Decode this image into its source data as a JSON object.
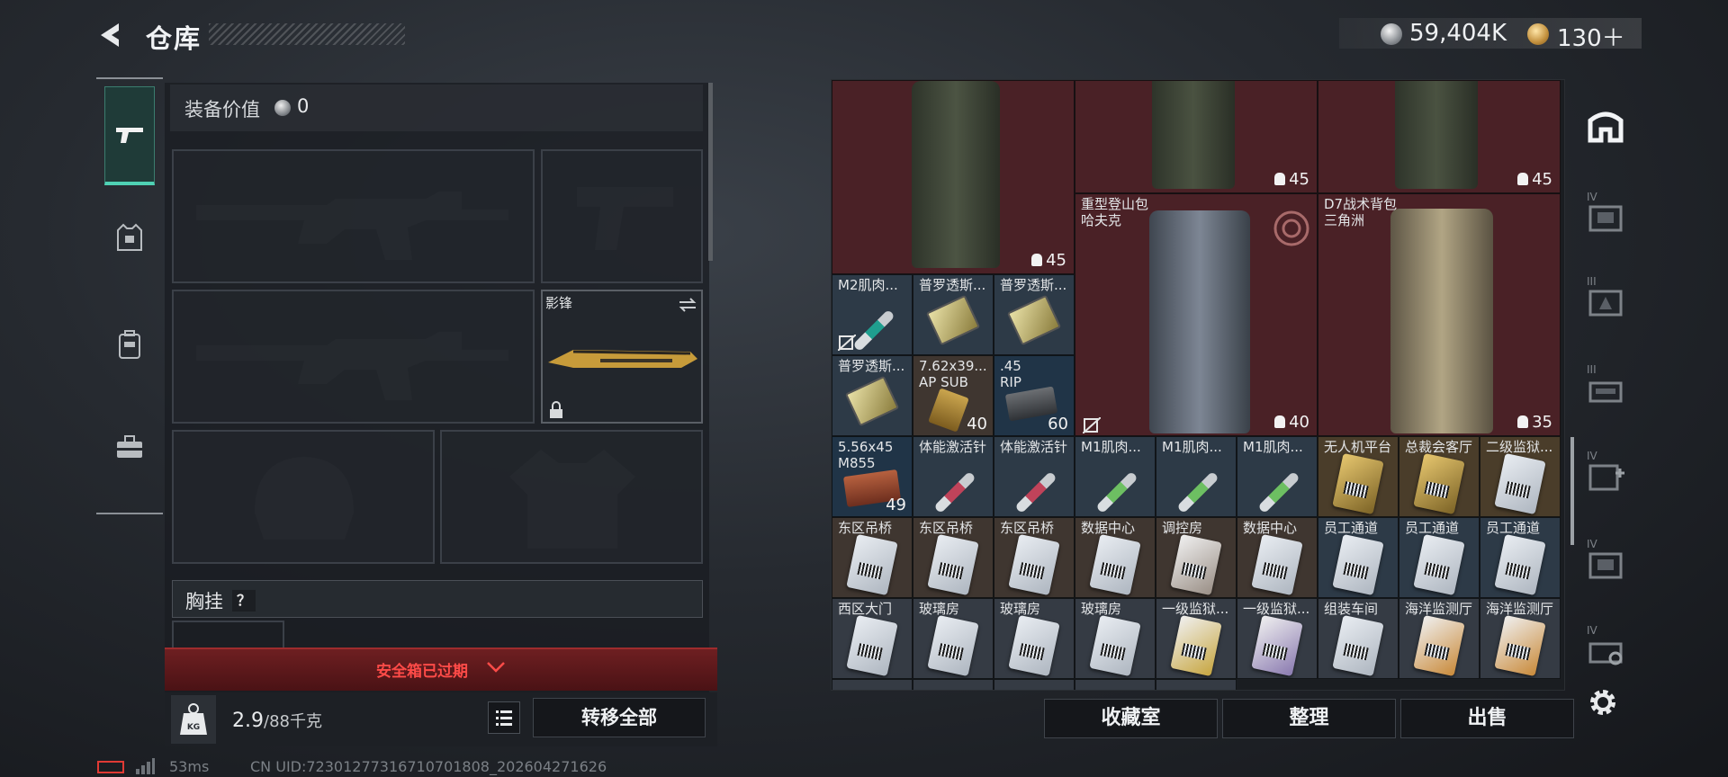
{
  "header": {
    "title": "仓库",
    "money": "59,404K",
    "tokens": "130＋"
  },
  "equipment": {
    "value_label": "装备价值",
    "value": "0",
    "melee_name": "影锋",
    "chest_rig_label": "胸挂",
    "help_mark": "？",
    "safebox_expired": "安全箱已过期"
  },
  "weight": {
    "value": "2.9",
    "unit": "/88千克",
    "kg_label": "KG"
  },
  "buttons": {
    "transfer_all": "转移全部",
    "collection_room": "收藏室",
    "sort": "整理",
    "sell": "出售"
  },
  "status": {
    "ping": "53ms",
    "uid": "CN UID:72301277316710701808_202604271626"
  },
  "grid": {
    "bag_weights": [
      "45",
      "45",
      "45",
      "40",
      "35"
    ],
    "bag_named": [
      {
        "line1": "重型登山包",
        "line2": "哈夫克"
      },
      {
        "line1": "D7战术背包",
        "line2": "三角洲"
      }
    ],
    "row1": [
      {
        "name": "M2肌肉...",
        "count": ""
      },
      {
        "name": "普罗透斯...",
        "count": ""
      },
      {
        "name": "普罗透斯...",
        "count": ""
      }
    ],
    "row2": [
      {
        "name": "普罗透斯...",
        "count": ""
      },
      {
        "name": "7.62x39...",
        "sub": "AP SUB",
        "count": "40"
      },
      {
        "name": ".45",
        "sub": "RIP",
        "count": "60"
      }
    ],
    "row3": [
      {
        "name": "5.56x45",
        "sub": "M855",
        "count": "49"
      },
      {
        "name": "体能激活针",
        "count": ""
      },
      {
        "name": "体能激活针",
        "count": ""
      },
      {
        "name": "M1肌肉...",
        "count": ""
      },
      {
        "name": "M1肌肉...",
        "count": ""
      },
      {
        "name": "M1肌肉...",
        "count": ""
      },
      {
        "name": "无人机平台",
        "count": ""
      },
      {
        "name": "总裁会客厅",
        "count": ""
      },
      {
        "name": "二级监狱...",
        "count": ""
      }
    ],
    "row4": [
      {
        "name": "东区吊桥"
      },
      {
        "name": "东区吊桥"
      },
      {
        "name": "东区吊桥"
      },
      {
        "name": "数据中心"
      },
      {
        "name": "调控房"
      },
      {
        "name": "数据中心"
      },
      {
        "name": "员工通道"
      },
      {
        "name": "员工通道"
      },
      {
        "name": "员工通道"
      }
    ],
    "row5": [
      {
        "name": "西区大门"
      },
      {
        "name": "玻璃房"
      },
      {
        "name": "玻璃房"
      },
      {
        "name": "玻璃房"
      },
      {
        "name": "一级监狱..."
      },
      {
        "name": "一级监狱..."
      },
      {
        "name": "组装车间"
      },
      {
        "name": "海洋监测厅"
      },
      {
        "name": "海洋监测厅"
      }
    ]
  },
  "right_nav": {
    "tiers": [
      "IV",
      "III",
      "III",
      "IV",
      "IV",
      "IV"
    ]
  },
  "colors": {
    "accent_teal": "#4fd1b4",
    "expired_red": "#ff4b48",
    "grid_red": "#4a2126"
  }
}
